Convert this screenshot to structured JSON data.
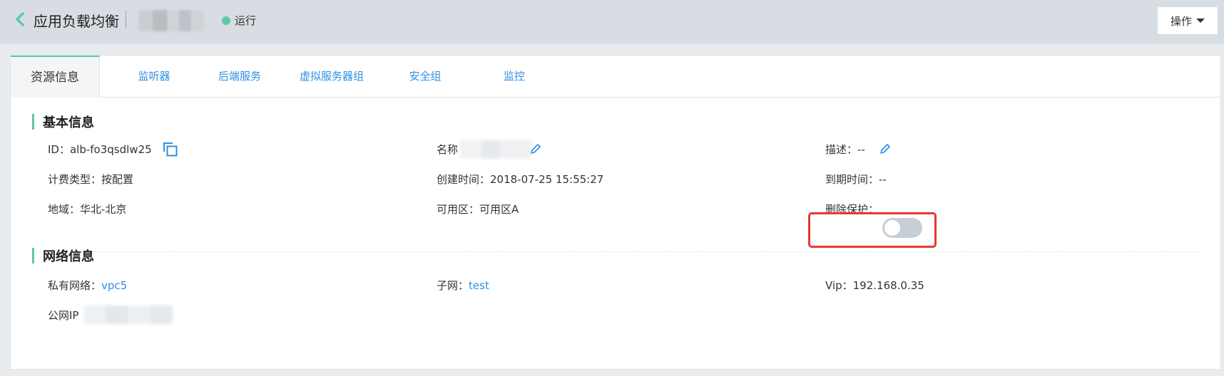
{
  "header": {
    "title": "应用负载均衡",
    "status": "运行",
    "status_color": "#5dc7a6",
    "ops_label": "操作"
  },
  "tabs": [
    {
      "label": "资源信息",
      "active": true
    },
    {
      "label": "监听器"
    },
    {
      "label": "后端服务"
    },
    {
      "label": "虚拟服务器组"
    },
    {
      "label": "安全组"
    },
    {
      "label": "监控"
    }
  ],
  "basic": {
    "title": "基本信息",
    "id_label": "ID：alb-fo3qsdlw25",
    "name_label": "名称",
    "desc_label": "描述：--",
    "billing_label": "计费类型：按配置",
    "created_label": "创建时间：2018-07-25 15:55:27",
    "expire_label": "到期时间：--",
    "region_label": "地域：华北-北京",
    "az_label": "可用区：可用区A",
    "delete_protect_label": "删除保护：",
    "delete_protect_on": false
  },
  "network": {
    "title": "网络信息",
    "vpc_label": "私有网络：",
    "vpc_value": "vpc5",
    "subnet_label": "子网：",
    "subnet_value": "test",
    "vip_label": "Vip：192.168.0.35",
    "public_ip_label": "公网IP"
  },
  "colors": {
    "accent": "#5dc7a6",
    "link": "#2f8fe0",
    "highlight": "#e53935"
  }
}
